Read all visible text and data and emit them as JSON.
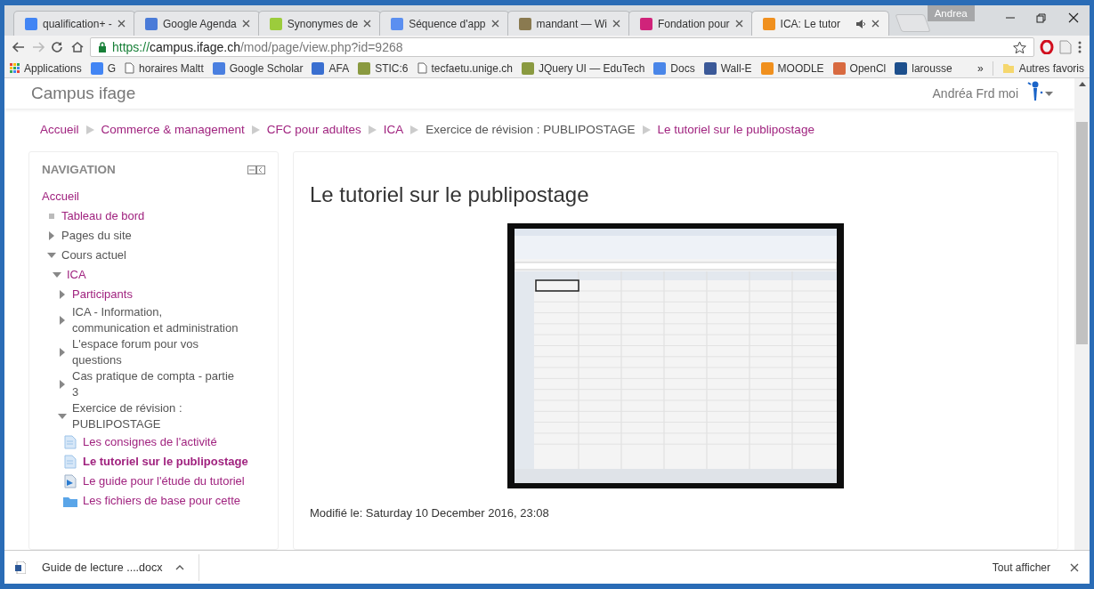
{
  "browser": {
    "tabs": [
      {
        "title": "qualification+ -",
        "color": "#4285f4",
        "selected": false,
        "audio": false
      },
      {
        "title": "Google Agenda",
        "color": "#4a7bd8",
        "selected": false,
        "audio": false
      },
      {
        "title": "Synonymes de",
        "color": "#9ccc3c",
        "selected": false,
        "audio": false
      },
      {
        "title": "Séquence d'app",
        "color": "#5b8ff0",
        "selected": false,
        "audio": false
      },
      {
        "title": "mandant — Wi",
        "color": "#8a7a50",
        "selected": false,
        "audio": false
      },
      {
        "title": "Fondation pour",
        "color": "#d0237a",
        "selected": false,
        "audio": false
      },
      {
        "title": "ICA: Le tutor",
        "color": "#f0901e",
        "selected": true,
        "audio": true
      }
    ],
    "profile": "Andrea",
    "url": {
      "scheme": "https://",
      "host": "campus.ifage.ch",
      "path": "/mod/page/view.php?id=9268"
    },
    "bookmarks": [
      {
        "label": "Applications",
        "kind": "grid"
      },
      {
        "label": "G",
        "kind": "tile",
        "color": "#4285f4"
      },
      {
        "label": "horaires Maltt",
        "kind": "page"
      },
      {
        "label": "Google Scholar",
        "kind": "tile",
        "color": "#4a7fe0"
      },
      {
        "label": "AFA",
        "kind": "tile",
        "color": "#3a6fd0"
      },
      {
        "label": "STIC:6",
        "kind": "tile",
        "color": "#8a9a40"
      },
      {
        "label": "tecfaetu.unige.ch",
        "kind": "page"
      },
      {
        "label": "JQuery UI — EduTech",
        "kind": "tile",
        "color": "#8a9a40"
      },
      {
        "label": "Docs",
        "kind": "tile",
        "color": "#4a86e8"
      },
      {
        "label": "Wall-E",
        "kind": "tile",
        "color": "#3b5998"
      },
      {
        "label": "MOODLE",
        "kind": "tile",
        "color": "#f0901e"
      },
      {
        "label": "OpenCl",
        "kind": "tile",
        "color": "#d86a40"
      },
      {
        "label": "larousse",
        "kind": "tile",
        "color": "#1d4f8c"
      }
    ],
    "overflow": "»",
    "other_bookmarks": "Autres favoris"
  },
  "site": {
    "brand": "Campus ifage",
    "user": "Andréa Frd moi"
  },
  "breadcrumb": [
    {
      "label": "Accueil",
      "link": true
    },
    {
      "label": "Commerce & management",
      "link": true
    },
    {
      "label": "CFC pour adultes",
      "link": true
    },
    {
      "label": "ICA",
      "link": true
    },
    {
      "label": "Exercice de révision : PUBLIPOSTAGE",
      "link": false
    },
    {
      "label": "Le tutoriel sur le publipostage",
      "link": true
    }
  ],
  "navigation": {
    "title": "NAVIGATION",
    "items": [
      {
        "label": "Accueil",
        "kind": "root",
        "link": true,
        "selected": false,
        "children": [
          {
            "label": "Tableau de bord",
            "kind": "bullet",
            "link": true,
            "selected": false
          },
          {
            "label": "Pages du site",
            "kind": "branch",
            "link": false,
            "expanded": false,
            "selected": false
          },
          {
            "label": "Cours actuel",
            "kind": "branch",
            "link": false,
            "expanded": true,
            "selected": false,
            "children": [
              {
                "label": "ICA",
                "kind": "branch",
                "link": true,
                "expanded": true,
                "selected": false,
                "children": [
                  {
                    "label": "Participants",
                    "kind": "branch",
                    "link": true,
                    "expanded": false,
                    "selected": false
                  },
                  {
                    "label": "ICA - Information, communication et administration",
                    "kind": "branch",
                    "link": false,
                    "expanded": false,
                    "selected": false
                  },
                  {
                    "label": "L'espace forum pour vos questions",
                    "kind": "branch",
                    "link": false,
                    "expanded": false,
                    "selected": false
                  },
                  {
                    "label": "Cas pratique de compta - partie 3",
                    "kind": "branch",
                    "link": false,
                    "expanded": false,
                    "selected": false
                  },
                  {
                    "label": "Exercice de révision : PUBLIPOSTAGE",
                    "kind": "branch",
                    "link": false,
                    "expanded": true,
                    "selected": false,
                    "children": [
                      {
                        "label": "Les consignes de l'activité",
                        "kind": "page",
                        "link": true,
                        "selected": false
                      },
                      {
                        "label": "Le tutoriel sur le publipostage",
                        "kind": "page",
                        "link": true,
                        "selected": true
                      },
                      {
                        "label": "Le guide pour l'étude du tutoriel",
                        "kind": "file",
                        "link": true,
                        "selected": false
                      },
                      {
                        "label": "Les fichiers de base pour cette",
                        "kind": "folder",
                        "link": true,
                        "selected": false
                      }
                    ]
                  }
                ]
              }
            ]
          }
        ]
      }
    ]
  },
  "content": {
    "title": "Le tutoriel sur le publipostage",
    "modified": "Modifié le: Saturday 10 December 2016, 23:08"
  },
  "downloads": {
    "file": "Guide de lecture ....docx",
    "show_all": "Tout afficher"
  }
}
